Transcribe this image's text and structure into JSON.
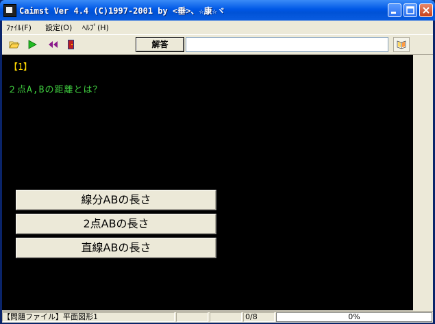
{
  "window": {
    "title": "Caimst Ver 4.4 (C)1997-2001  by <垂>、☆康☆ヾ"
  },
  "menu": {
    "file": "ﾌｧｲﾙ(F)",
    "settings": "設定(O)",
    "help": "ﾍﾙﾌﾟ(H)"
  },
  "toolbar": {
    "open_icon": "folder-open-icon",
    "play_icon": "play-icon",
    "rewind_icon": "rewind-icon",
    "exit_icon": "door-exit-icon",
    "answer_label": "解答",
    "answer_value": "",
    "answer_placeholder": "",
    "help_icon": "book-icon"
  },
  "question": {
    "number": "【1】",
    "text": "２点A,Bの距離とは？",
    "choices": [
      "線分ABの長さ",
      "2点ABの長さ",
      "直線ABの長さ"
    ]
  },
  "status": {
    "file": "【問題ファイル】平面図形1",
    "count": "0/8",
    "progress_text": "0%",
    "progress_value": 0
  },
  "colors": {
    "question_number": "#ffd800",
    "question_text": "#40d040",
    "background": "#000000"
  }
}
